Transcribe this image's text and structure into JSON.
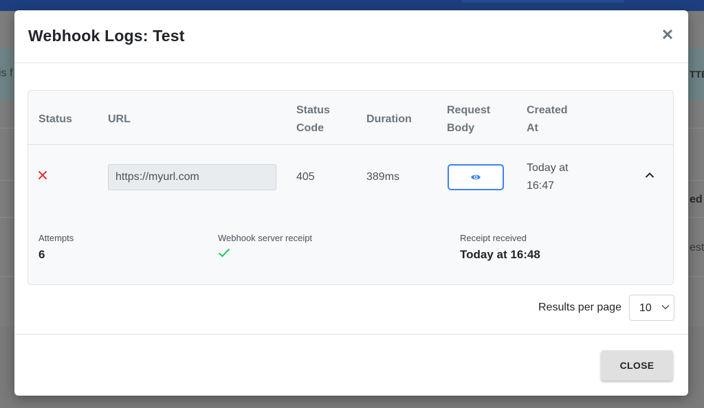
{
  "background": {
    "fragments": [
      "is f",
      "TTER",
      "ed b",
      "est"
    ]
  },
  "modal": {
    "title": "Webhook Logs: Test",
    "close_icon": "close-icon"
  },
  "table": {
    "headers": {
      "status": "Status",
      "url": "URL",
      "status_code_1": "Status",
      "status_code_2": "Code",
      "duration": "Duration",
      "request_body_1": "Request",
      "request_body_2": "Body",
      "created_at_1": "Created",
      "created_at_2": "At"
    },
    "rows": [
      {
        "status_icon": "error-x-icon",
        "url": "https://myurl.com",
        "status_code": "405",
        "duration": "389ms",
        "request_body_icon": "eye-icon",
        "created_at_1": "Today at",
        "created_at_2": "16:47",
        "expand_icon": "chevron-up-icon"
      }
    ],
    "details": {
      "attempts_label": "Attempts",
      "attempts_value": "6",
      "receipt_label": "Webhook server receipt",
      "receipt_icon": "check-icon",
      "received_label": "Receipt received",
      "received_value": "Today at 16:48"
    }
  },
  "pagination": {
    "results_per_page_label": "Results per page",
    "results_per_page_value": "10"
  },
  "footer": {
    "close_label": "CLOSE"
  },
  "colors": {
    "error": "#e03131",
    "success": "#22c55e",
    "accent": "#3b82f6",
    "topbar": "#1d3f80"
  }
}
